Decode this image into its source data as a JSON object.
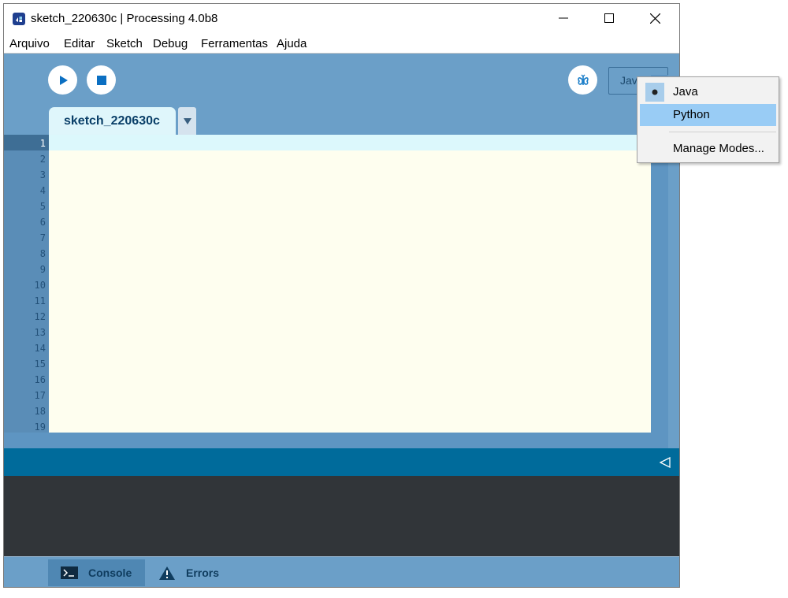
{
  "window": {
    "title": "sketch_220630c | Processing 4.0b8"
  },
  "menu": [
    "Arquivo",
    "Editar",
    "Sketch",
    "Debug",
    "Ferramentas",
    "Ajuda"
  ],
  "toolbar": {
    "run_icon": "play-icon",
    "stop_icon": "stop-icon",
    "debug_icon": "butterfly-icon",
    "mode_label": "Java"
  },
  "editor": {
    "tab_name": "sketch_220630c",
    "line_numbers": [
      "1",
      "2",
      "3",
      "4",
      "5",
      "6",
      "7",
      "8",
      "9",
      "10",
      "11",
      "12",
      "13",
      "14",
      "15",
      "16",
      "17",
      "18",
      "19"
    ],
    "current_line": "1",
    "background": "#fefeef",
    "current_line_color": "#dcf8fc"
  },
  "mode_popup": {
    "items": [
      "Java",
      "Python",
      "Manage Modes..."
    ],
    "selected": "Java",
    "highlighted": "Python",
    "highlight_color": "#99ccf5"
  },
  "bottom_tabs": {
    "console": "Console",
    "errors": "Errors"
  },
  "colors": {
    "toolbar_bg": "#6b9fc8",
    "console_bar": "#006b9b",
    "console_bg": "#313539"
  }
}
